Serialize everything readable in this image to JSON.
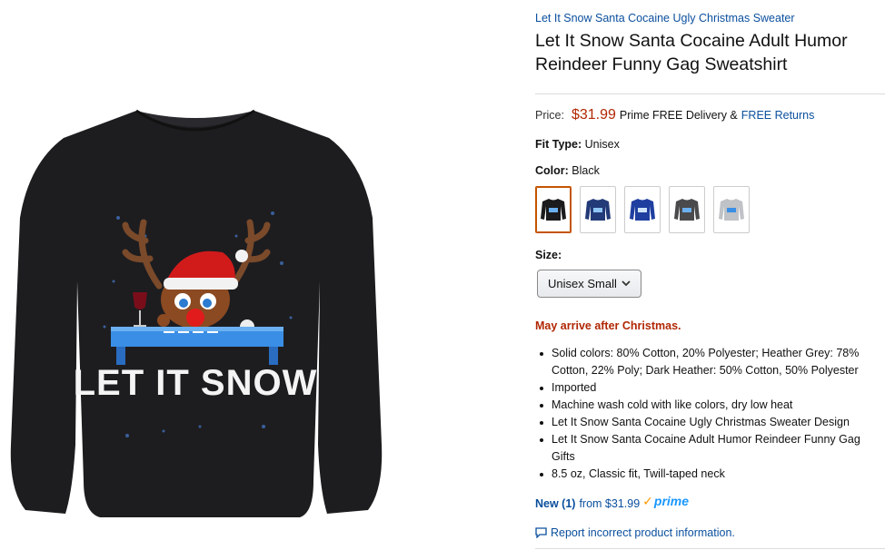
{
  "product": {
    "brand_link": "Let It Snow Santa Cocaine Ugly Christmas Sweater",
    "title": "Let It Snow Santa Cocaine Adult Humor Reindeer Funny Gag Sweatshirt",
    "image_text": "LET IT SNOW"
  },
  "price": {
    "label": "Price:",
    "value": "$31.99",
    "prime_text": "Prime FREE Delivery &",
    "returns_link": "FREE Returns"
  },
  "fit_type": {
    "label": "Fit Type:",
    "value": "Unisex"
  },
  "color": {
    "label": "Color:",
    "value": "Black",
    "swatches": [
      {
        "name": "Black",
        "hex": "#1b1b1d",
        "selected": true
      },
      {
        "name": "Navy",
        "hex": "#233a78",
        "selected": false
      },
      {
        "name": "Royal Blue",
        "hex": "#1f3fa0",
        "selected": false
      },
      {
        "name": "Dark Heather",
        "hex": "#4a4a4c",
        "selected": false
      },
      {
        "name": "Heather Grey",
        "hex": "#bfc2c6",
        "selected": false
      }
    ]
  },
  "size": {
    "label": "Size:",
    "selected": "Unisex Small"
  },
  "availability": "May arrive after Christmas.",
  "bullets": [
    "Solid colors: 80% Cotton, 20% Polyester; Heather Grey: 78% Cotton, 22% Poly; Dark Heather: 50% Cotton, 50% Polyester",
    "Imported",
    "Machine wash cold with like colors, dry low heat",
    "Let It Snow Santa Cocaine Ugly Christmas Sweater Design",
    "Let It Snow Santa Cocaine Adult Humor Reindeer Funny Gag Gifts",
    "8.5 oz, Classic fit, Twill-taped neck"
  ],
  "offers": {
    "new_link": "New (1)",
    "from_text": "from $31.99",
    "prime_logo": "prime"
  },
  "report_link": "Report incorrect product information.",
  "colors": {
    "link": "#0a4f9e",
    "price": "#b12704",
    "selected_border": "#c45500",
    "prime_blue": "#1a98ff",
    "prime_check": "#ff9900"
  }
}
